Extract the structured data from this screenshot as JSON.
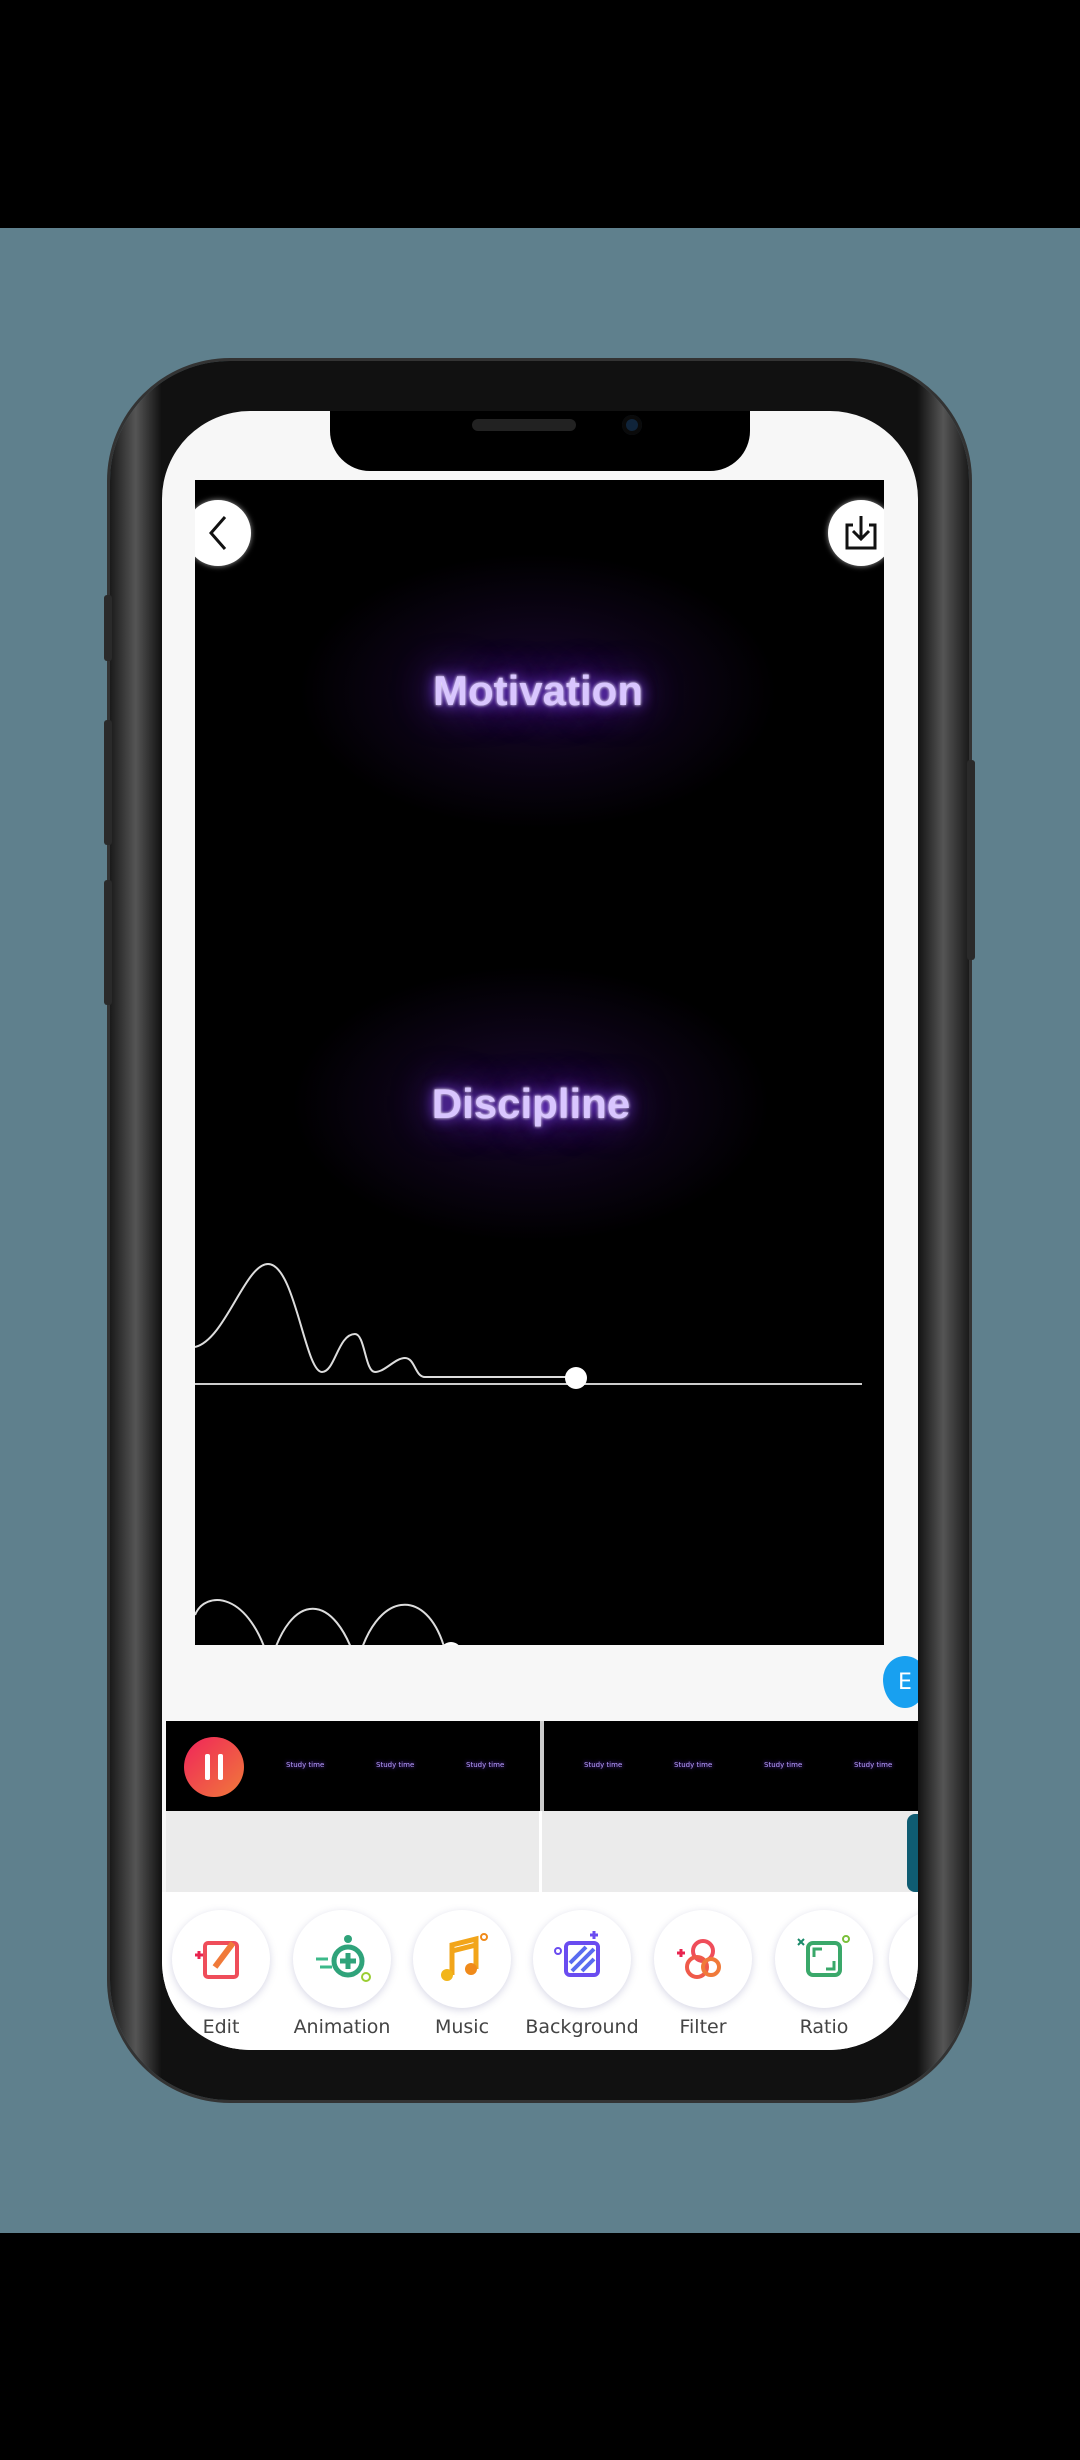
{
  "video": {
    "title_1": "Motivation",
    "title_2": "Discipline"
  },
  "buttons": {
    "back": "back",
    "download": "download"
  },
  "balloon_letter": "E",
  "timeline": {
    "thumb_text": "Study time",
    "clips": 2
  },
  "toolbar": {
    "items": [
      {
        "label": "Edit",
        "icon": "edit-pencil-icon",
        "color": "#ef4d5a"
      },
      {
        "label": "Animation",
        "icon": "animation-plus-icon",
        "color": "#2fa37a"
      },
      {
        "label": "Music",
        "icon": "music-note-icon",
        "color": "#f2a51a"
      },
      {
        "label": "Background",
        "icon": "background-pattern-icon",
        "color": "#6a4cf0"
      },
      {
        "label": "Filter",
        "icon": "filter-circles-icon",
        "color": "#ef5a4a"
      },
      {
        "label": "Ratio",
        "icon": "ratio-frame-icon",
        "color": "#3aa86a"
      }
    ]
  },
  "colors": {
    "accent": "#f0245a",
    "glow": "#8a4dff"
  }
}
